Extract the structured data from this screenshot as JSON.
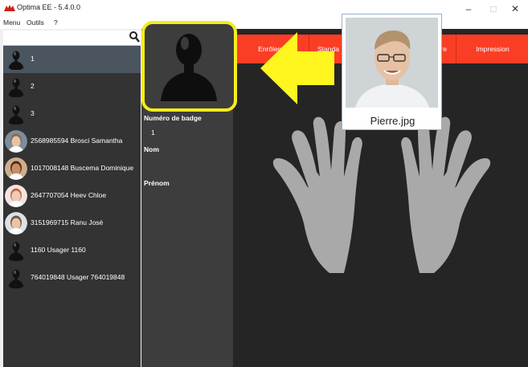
{
  "window": {
    "title": "Optima EE - 5.4.0.0"
  },
  "menu": {
    "items": [
      "Menu",
      "Outils",
      "?"
    ]
  },
  "search": {
    "value": ""
  },
  "users": [
    {
      "text": "1",
      "avatar": "silhouette",
      "selected": true
    },
    {
      "text": "2",
      "avatar": "silhouette"
    },
    {
      "text": "3",
      "avatar": "silhouette"
    },
    {
      "text": "2568985594  Brosci  Samantha",
      "avatar": "photo"
    },
    {
      "text": "1017008148  Buscema  Dominique",
      "avatar": "photo"
    },
    {
      "text": "2647707054  Heev  Chloe",
      "avatar": "photo"
    },
    {
      "text": "3151969715  Ranu  José",
      "avatar": "photo"
    },
    {
      "text": "1160  Usager  1160",
      "avatar": "silhouette"
    },
    {
      "text": "764019848  Usager  764019848",
      "avatar": "silhouette"
    }
  ],
  "details": {
    "badge_label": "Numéro de badge",
    "badge_value": "1",
    "nom_label": "Nom",
    "prenom_label": "Prénom"
  },
  "tabs": [
    "Enrôlem",
    "Standa",
    "re",
    "Impression"
  ],
  "overlay": {
    "filename": "Pierre.jpg"
  },
  "colors": {
    "accent": "#fa3e25",
    "highlight": "#f5ec1d",
    "list_bg": "#333333",
    "selected": "#4b5560"
  }
}
